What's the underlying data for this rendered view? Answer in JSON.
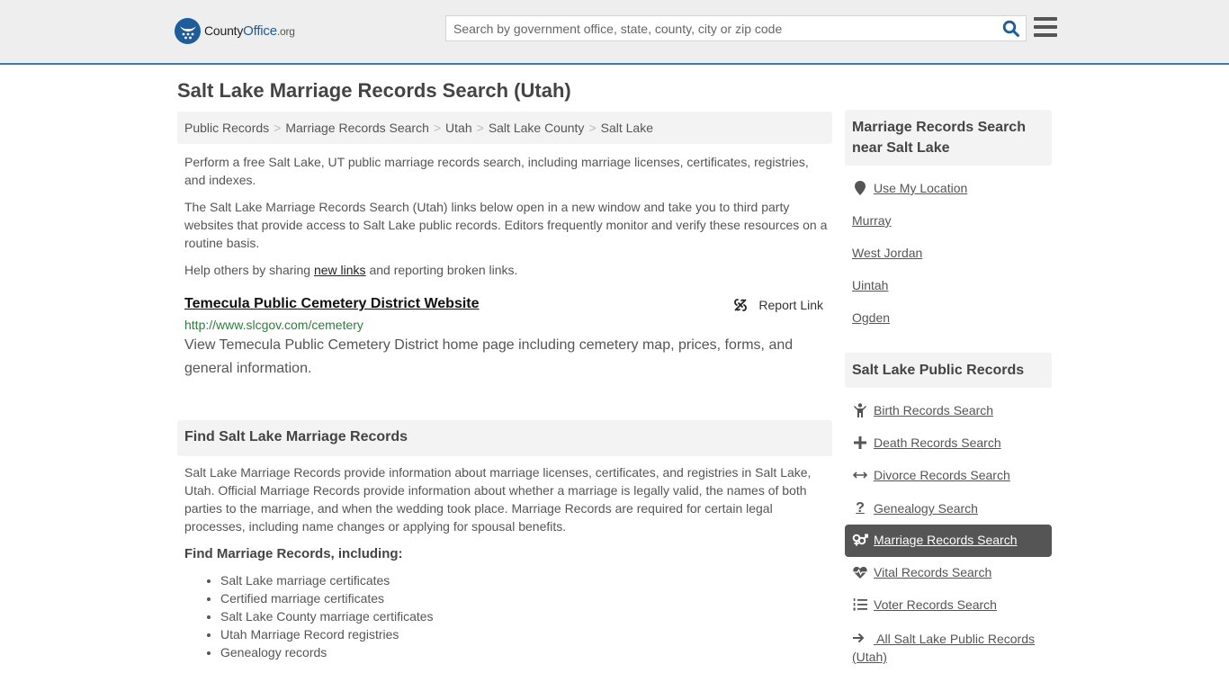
{
  "header": {
    "logo": {
      "brand_main": "County",
      "brand_accent": "Office",
      "brand_suffix": ".org"
    },
    "search": {
      "placeholder": "Search by government office, state, county, city or zip code",
      "value": ""
    },
    "search_icon": "search-icon",
    "menu_icon": "hamburger-menu-icon"
  },
  "colors": {
    "brand": "#1e5c9b",
    "header_bg": "#eeeeee",
    "header_border": "#3a7bb0",
    "url_green": "#2f7d3e",
    "active_bg": "#555555"
  },
  "page": {
    "title": "Salt Lake Marriage Records Search (Utah)"
  },
  "breadcrumb": [
    {
      "label": "Public Records"
    },
    {
      "label": "Marriage Records Search"
    },
    {
      "label": "Utah"
    },
    {
      "label": "Salt Lake County"
    },
    {
      "label": "Salt Lake"
    }
  ],
  "breadcrumb_separator": ">",
  "intro": {
    "p1": "Perform a free Salt Lake, UT public marriage records search, including marriage licenses, certificates, registries, and indexes.",
    "p2": "The Salt Lake Marriage Records Search (Utah) links below open in a new window and take you to third party websites that provide access to Salt Lake public records. Editors frequently monitor and verify these resources on a routine basis.",
    "p3_before": "Help others by sharing ",
    "p3_link": "new links",
    "p3_after": " and reporting broken links."
  },
  "result": {
    "title": "Temecula Public Cemetery District Website",
    "url": "http://www.slcgov.com/cemetery",
    "description": "View Temecula Public Cemetery District home page including cemetery map, prices, forms, and general information.",
    "report_label": "Report Link"
  },
  "find_section": {
    "heading": "Find Salt Lake Marriage Records",
    "body": "Salt Lake Marriage Records provide information about marriage licenses, certificates, and registries in Salt Lake, Utah. Official Marriage Records provide information about whether a marriage is legally valid, the names of both parties to the marriage, and when the wedding took place. Marriage Records are required for certain legal processes, including name changes or applying for spousal benefits.",
    "subheading": "Find Marriage Records, including:",
    "items": [
      "Salt Lake marriage certificates",
      "Certified marriage certificates",
      "Salt Lake County marriage certificates",
      "Utah Marriage Record registries",
      "Genealogy records"
    ]
  },
  "sidebar": {
    "near": {
      "heading": "Marriage Records Search near Salt Lake",
      "use_location": "Use My Location",
      "places": [
        "Murray",
        "West Jordan",
        "Uintah",
        "Ogden"
      ]
    },
    "public": {
      "heading": "Salt Lake Public Records",
      "links": [
        {
          "label": "Birth Records Search",
          "icon": "child-icon"
        },
        {
          "label": "Death Records Search",
          "icon": "cross-icon"
        },
        {
          "label": "Divorce Records Search",
          "icon": "arrows-horizontal-icon"
        },
        {
          "label": "Genealogy Search",
          "icon": "question-icon"
        },
        {
          "label": "Marriage Records Search",
          "icon": "gender-symbols-icon",
          "active": true
        },
        {
          "label": "Vital Records Search",
          "icon": "heartbeat-icon"
        },
        {
          "label": "Voter Records Search",
          "icon": "list-ol-icon"
        },
        {
          "label": "All Salt Lake Public Records (Utah)",
          "icon": "arrow-right-icon"
        }
      ]
    }
  }
}
